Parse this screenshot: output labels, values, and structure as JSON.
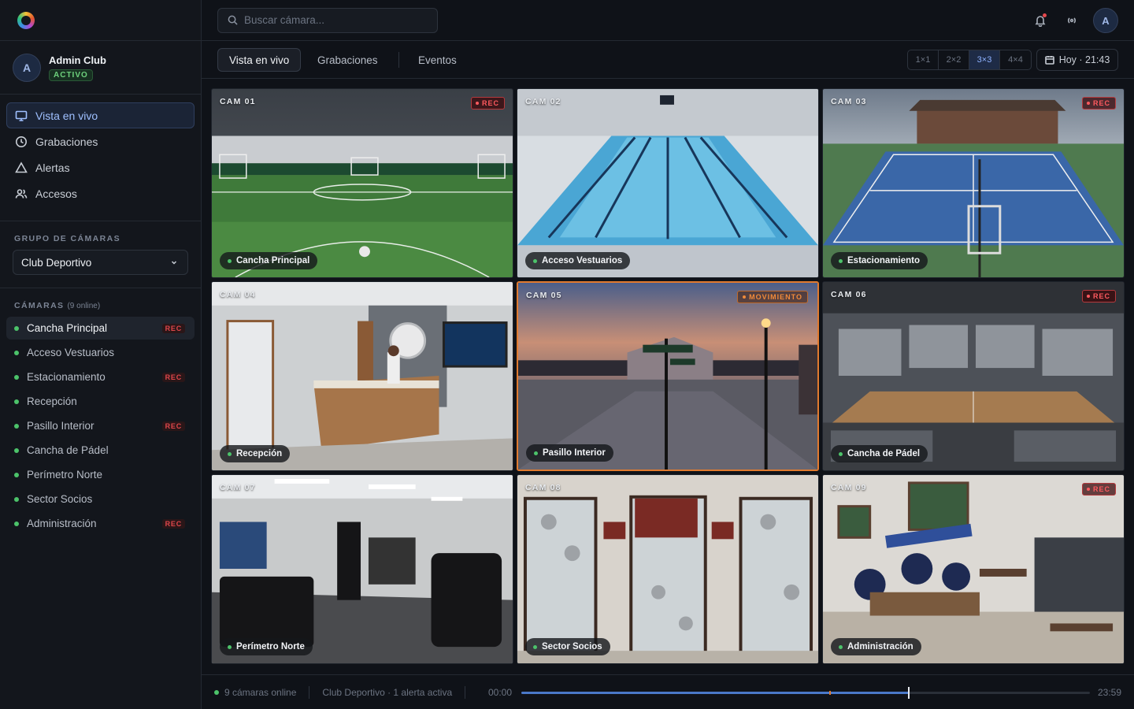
{
  "user": {
    "initial": "A",
    "name": "Admin Club",
    "status": "ACTIVO"
  },
  "nav": [
    {
      "label": "Vista en vivo",
      "icon": "monitor-icon",
      "active": true
    },
    {
      "label": "Grabaciones",
      "icon": "clock-icon"
    },
    {
      "label": "Alertas",
      "icon": "alert-triangle-icon"
    },
    {
      "label": "Accesos",
      "icon": "users-icon"
    }
  ],
  "camera_group": {
    "label": "GRUPO DE CÁMARAS",
    "selected": "Club Deportivo"
  },
  "cameras_section": {
    "label": "CÁMARAS",
    "count": "(9 online)"
  },
  "camera_list": [
    {
      "name": "Cancha Principal",
      "rec": "REC",
      "active": true
    },
    {
      "name": "Acceso Vestuarios",
      "rec": ""
    },
    {
      "name": "Estacionamiento",
      "rec": "REC"
    },
    {
      "name": "Recepción",
      "rec": ""
    },
    {
      "name": "Pasillo Interior",
      "rec": "REC"
    },
    {
      "name": "Cancha de Pádel",
      "rec": ""
    },
    {
      "name": "Perímetro Norte",
      "rec": ""
    },
    {
      "name": "Sector Socios",
      "rec": ""
    },
    {
      "name": "Administración",
      "rec": "REC"
    }
  ],
  "search": {
    "placeholder": "Buscar cámara..."
  },
  "topbar": {
    "avatar_initial": "A"
  },
  "tabs": [
    "Vista en vivo",
    "Grabaciones",
    "Eventos"
  ],
  "layouts": {
    "options": [
      "1×1",
      "2×2",
      "3×3",
      "4×4"
    ],
    "selected": "3×3"
  },
  "date_button": "Hoy · 21:43",
  "tiles": [
    {
      "id": "CAM 01",
      "label": "Cancha Principal",
      "badge": "REC",
      "scene": "soccer"
    },
    {
      "id": "CAM 02",
      "label": "Acceso Vestuarios",
      "badge": "",
      "scene": "pool"
    },
    {
      "id": "CAM 03",
      "label": "Estacionamiento",
      "badge": "REC",
      "scene": "tennis"
    },
    {
      "id": "CAM 04",
      "label": "Recepción",
      "badge": "",
      "scene": "reception"
    },
    {
      "id": "CAM 05",
      "label": "Pasillo Interior",
      "badge": "MOVIMIENTO",
      "scene": "street",
      "alert": true
    },
    {
      "id": "CAM 06",
      "label": "Cancha de Pádel",
      "badge": "REC",
      "scene": "arena"
    },
    {
      "id": "CAM 07",
      "label": "Perímetro Norte",
      "badge": "",
      "scene": "gym"
    },
    {
      "id": "CAM 08",
      "label": "Sector Socios",
      "badge": "",
      "scene": "trophies"
    },
    {
      "id": "CAM 09",
      "label": "Administración",
      "badge": "REC",
      "scene": "lounge"
    }
  ],
  "status": {
    "online": "9 cámaras online",
    "summary": "Club Deportivo · 1 alerta activa",
    "start": "00:00",
    "end": "23:59",
    "progress": 0.682,
    "event_marks": [
      0.542
    ]
  },
  "colors": {
    "accent": "#4a78c9",
    "online": "#4cc36a",
    "rec": "#ff5a5f",
    "alert": "#e07a2f"
  }
}
